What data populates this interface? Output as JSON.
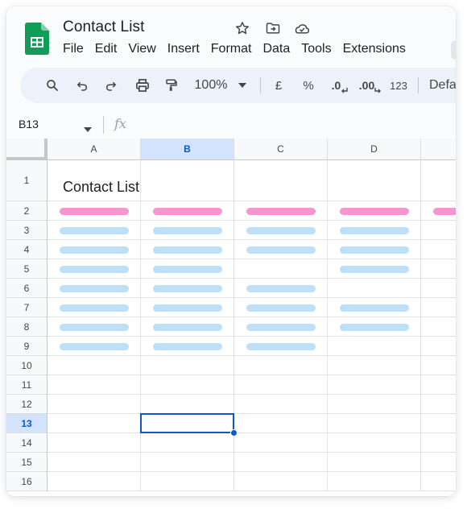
{
  "app": {
    "doc_title": "Contact List",
    "icons": [
      "sheets-logo-icon",
      "star-icon",
      "move-to-folder-icon",
      "cloud-saved-icon"
    ]
  },
  "menu": [
    "File",
    "Edit",
    "View",
    "Insert",
    "Format",
    "Data",
    "Tools",
    "Extensions"
  ],
  "toolbar": {
    "zoom": "100%",
    "currency": "£",
    "percent": "%",
    "decrease_decimals": ".0",
    "increase_decimals": ".00",
    "more_formats": "123",
    "font": "Defa",
    "icons": [
      "search-icon",
      "undo-icon",
      "redo-icon",
      "print-icon",
      "paint-format-icon",
      "zoom-dropdown-icon"
    ]
  },
  "formula_bar": {
    "name_box": "B13",
    "fx": "fx",
    "value": ""
  },
  "grid": {
    "columns": [
      "A",
      "B",
      "C",
      "D"
    ],
    "selected_column": "B",
    "rows": [
      "1",
      "2",
      "3",
      "4",
      "5",
      "6",
      "7",
      "8",
      "9",
      "10",
      "11",
      "12",
      "13",
      "14",
      "15",
      "16"
    ],
    "selected_row": "13",
    "title_cell": "Contact List",
    "header_row_color": "#f596cf",
    "data_bar_color": "#bde0f8",
    "placeholder_rows": [
      {
        "row": "2",
        "kind": "header",
        "filled": [
          "A",
          "B",
          "C",
          "D",
          "E"
        ]
      },
      {
        "row": "3",
        "kind": "data",
        "filled": [
          "A",
          "B",
          "C",
          "D"
        ]
      },
      {
        "row": "4",
        "kind": "data",
        "filled": [
          "A",
          "B",
          "C",
          "D"
        ]
      },
      {
        "row": "5",
        "kind": "data",
        "filled": [
          "A",
          "B",
          "D"
        ]
      },
      {
        "row": "6",
        "kind": "data",
        "filled": [
          "A",
          "B",
          "C"
        ]
      },
      {
        "row": "7",
        "kind": "data",
        "filled": [
          "A",
          "B",
          "C",
          "D"
        ]
      },
      {
        "row": "8",
        "kind": "data",
        "filled": [
          "A",
          "B",
          "C",
          "D"
        ]
      },
      {
        "row": "9",
        "kind": "data",
        "filled": [
          "A",
          "B",
          "C"
        ]
      }
    ]
  },
  "colors": {
    "accent": "#0b57d0",
    "selection_header": "#d3e3fd",
    "sheets_green": "#0f9d58"
  }
}
